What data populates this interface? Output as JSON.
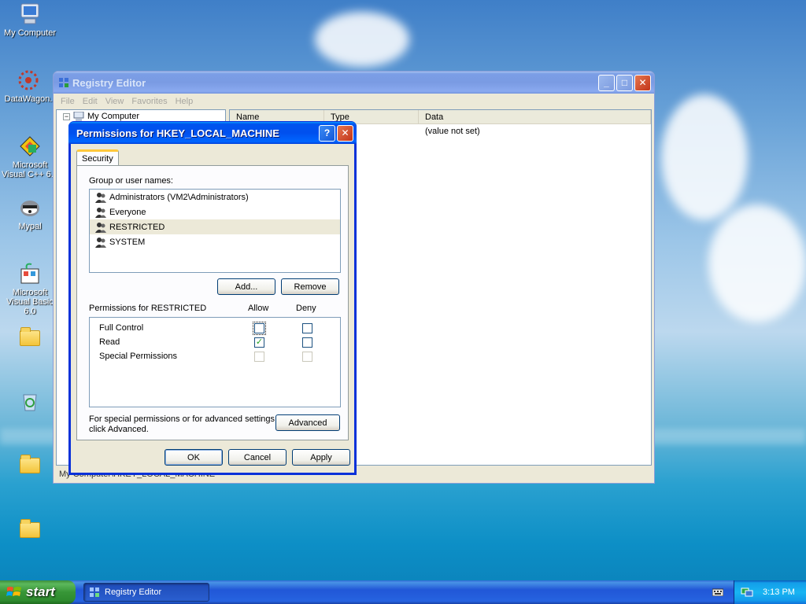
{
  "desktop": {
    "icons": [
      {
        "label": "My Computer",
        "icon": "my-computer-icon"
      },
      {
        "label": "DataWagon.",
        "icon": "datawagon-icon"
      },
      {
        "label": "Microsoft Visual C++ 6.0",
        "icon": "visual-cpp-icon"
      },
      {
        "label": "Mypal",
        "icon": "mypal-icon"
      },
      {
        "label": "Microsoft Visual Basic 6.0",
        "icon": "visual-basic-icon"
      },
      {
        "label": "",
        "icon": "folder-icon"
      },
      {
        "label": "",
        "icon": "recycle-bin-icon"
      },
      {
        "label": "",
        "icon": "folder-icon"
      },
      {
        "label": "",
        "icon": "folder-icon"
      }
    ]
  },
  "regedit": {
    "title": "Registry Editor",
    "menu": [
      "File",
      "Edit",
      "View",
      "Favorites",
      "Help"
    ],
    "tree": {
      "root": "My Computer",
      "expander": "−"
    },
    "columns": {
      "name": "Name",
      "type": "Type",
      "data": "Data"
    },
    "rows": [
      {
        "name": "",
        "type": "",
        "data": "(value not set)"
      }
    ],
    "status": "My Computer\\HKEY_LOCAL_MACHINE"
  },
  "dialog": {
    "title": "Permissions for HKEY_LOCAL_MACHINE",
    "help_glyph": "?",
    "close_glyph": "✕",
    "tab": "Security",
    "group_label": "Group or user names:",
    "users": [
      {
        "name": "Administrators (VM2\\Administrators)",
        "selected": false
      },
      {
        "name": "Everyone",
        "selected": false
      },
      {
        "name": "RESTRICTED",
        "selected": true
      },
      {
        "name": "SYSTEM",
        "selected": false
      }
    ],
    "add_button": "Add...",
    "remove_button": "Remove",
    "perm_label": "Permissions for RESTRICTED",
    "allow_label": "Allow",
    "deny_label": "Deny",
    "permissions": [
      {
        "name": "Full Control",
        "allow": false,
        "deny": false,
        "enabled": true
      },
      {
        "name": "Read",
        "allow": true,
        "deny": false,
        "enabled": true
      },
      {
        "name": "Special Permissions",
        "allow": false,
        "deny": false,
        "enabled": false
      }
    ],
    "advanced_text": "For special permissions or for advanced settings, click Advanced.",
    "advanced_button": "Advanced",
    "ok_button": "OK",
    "cancel_button": "Cancel",
    "apply_button": "Apply"
  },
  "taskbar": {
    "start_label": "start",
    "task": "Registry Editor",
    "clock": "3:13 PM"
  },
  "colors": {
    "titlebar_active": "#0053ee",
    "taskbar": "#2157d7",
    "start_green": "#379637",
    "checkmark": "#21a121"
  }
}
